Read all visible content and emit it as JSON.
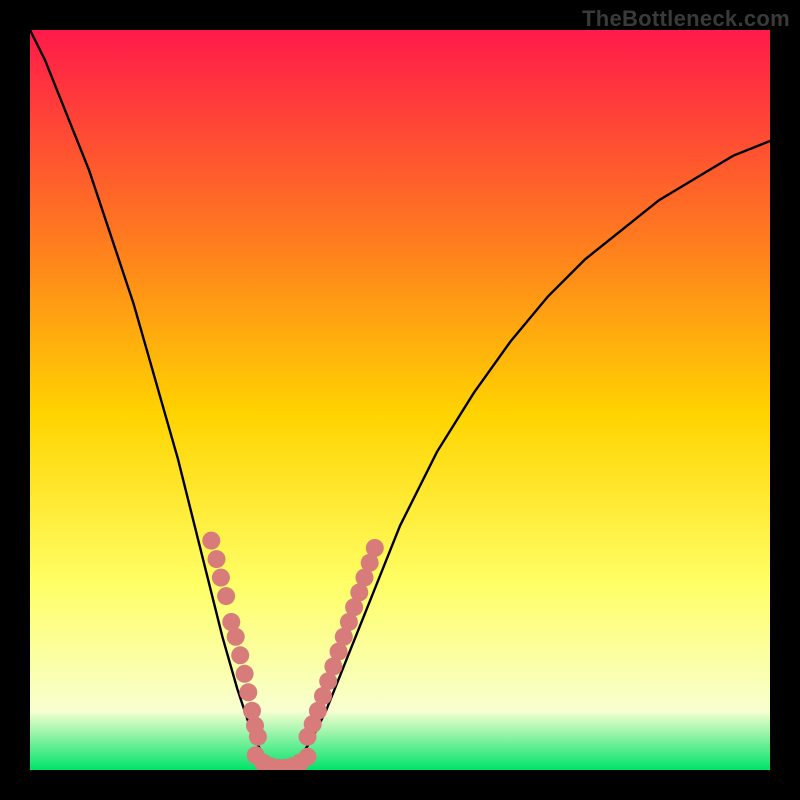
{
  "watermark": "TheBottleneck.com",
  "chart_data": {
    "type": "line",
    "title": "",
    "xlabel": "",
    "ylabel": "",
    "xlim": [
      0,
      100
    ],
    "ylim": [
      0,
      100
    ],
    "grid": false,
    "legend": false,
    "background_gradient": {
      "top": "#ff1a4a",
      "mid_upper": "#ff7a1f",
      "mid": "#ffd400",
      "mid_lower": "#ffff66",
      "lower": "#f8ffd0",
      "bottom": "#00e36b"
    },
    "series": [
      {
        "name": "curve",
        "color": "#000000",
        "x": [
          0,
          2,
          4,
          6,
          8,
          10,
          12,
          14,
          16,
          18,
          20,
          22,
          24,
          26,
          28,
          30,
          31,
          32,
          33,
          34,
          35,
          36,
          38,
          40,
          42,
          44,
          46,
          48,
          50,
          55,
          60,
          65,
          70,
          75,
          80,
          85,
          90,
          95,
          100
        ],
        "y": [
          100,
          96,
          91,
          86,
          81,
          75,
          69,
          63,
          56,
          49,
          42,
          34,
          26,
          18,
          11,
          5,
          3,
          1,
          0,
          0,
          0,
          1,
          4,
          8,
          13,
          18,
          23,
          28,
          33,
          43,
          51,
          58,
          64,
          69,
          73,
          77,
          80,
          83,
          85
        ]
      }
    ],
    "dot_clusters": [
      {
        "name": "cluster-left",
        "color": "#d77b7b",
        "points": [
          [
            24.5,
            31
          ],
          [
            25.2,
            28.5
          ],
          [
            25.8,
            26
          ],
          [
            26.5,
            23.5
          ],
          [
            27.2,
            20
          ],
          [
            27.8,
            18
          ],
          [
            28.4,
            15.5
          ],
          [
            29.0,
            13
          ],
          [
            29.5,
            10.5
          ],
          [
            30.0,
            8
          ],
          [
            30.4,
            6
          ],
          [
            30.8,
            4.5
          ]
        ]
      },
      {
        "name": "cluster-bottom",
        "color": "#d77b7b",
        "points": [
          [
            30.5,
            2
          ],
          [
            31.5,
            1
          ],
          [
            32.5,
            0.5
          ],
          [
            33.5,
            0.3
          ],
          [
            34.5,
            0.3
          ],
          [
            35.5,
            0.5
          ],
          [
            36.5,
            1
          ],
          [
            37.5,
            1.8
          ]
        ]
      },
      {
        "name": "cluster-right",
        "color": "#d77b7b",
        "points": [
          [
            37.5,
            4.5
          ],
          [
            38.2,
            6.2
          ],
          [
            38.9,
            8
          ],
          [
            39.6,
            10
          ],
          [
            40.3,
            12
          ],
          [
            41.0,
            14
          ],
          [
            41.7,
            16
          ],
          [
            42.4,
            18
          ],
          [
            43.1,
            20
          ],
          [
            43.8,
            22
          ],
          [
            44.5,
            24
          ],
          [
            45.2,
            26
          ],
          [
            45.9,
            28
          ],
          [
            46.6,
            30
          ]
        ]
      }
    ]
  }
}
